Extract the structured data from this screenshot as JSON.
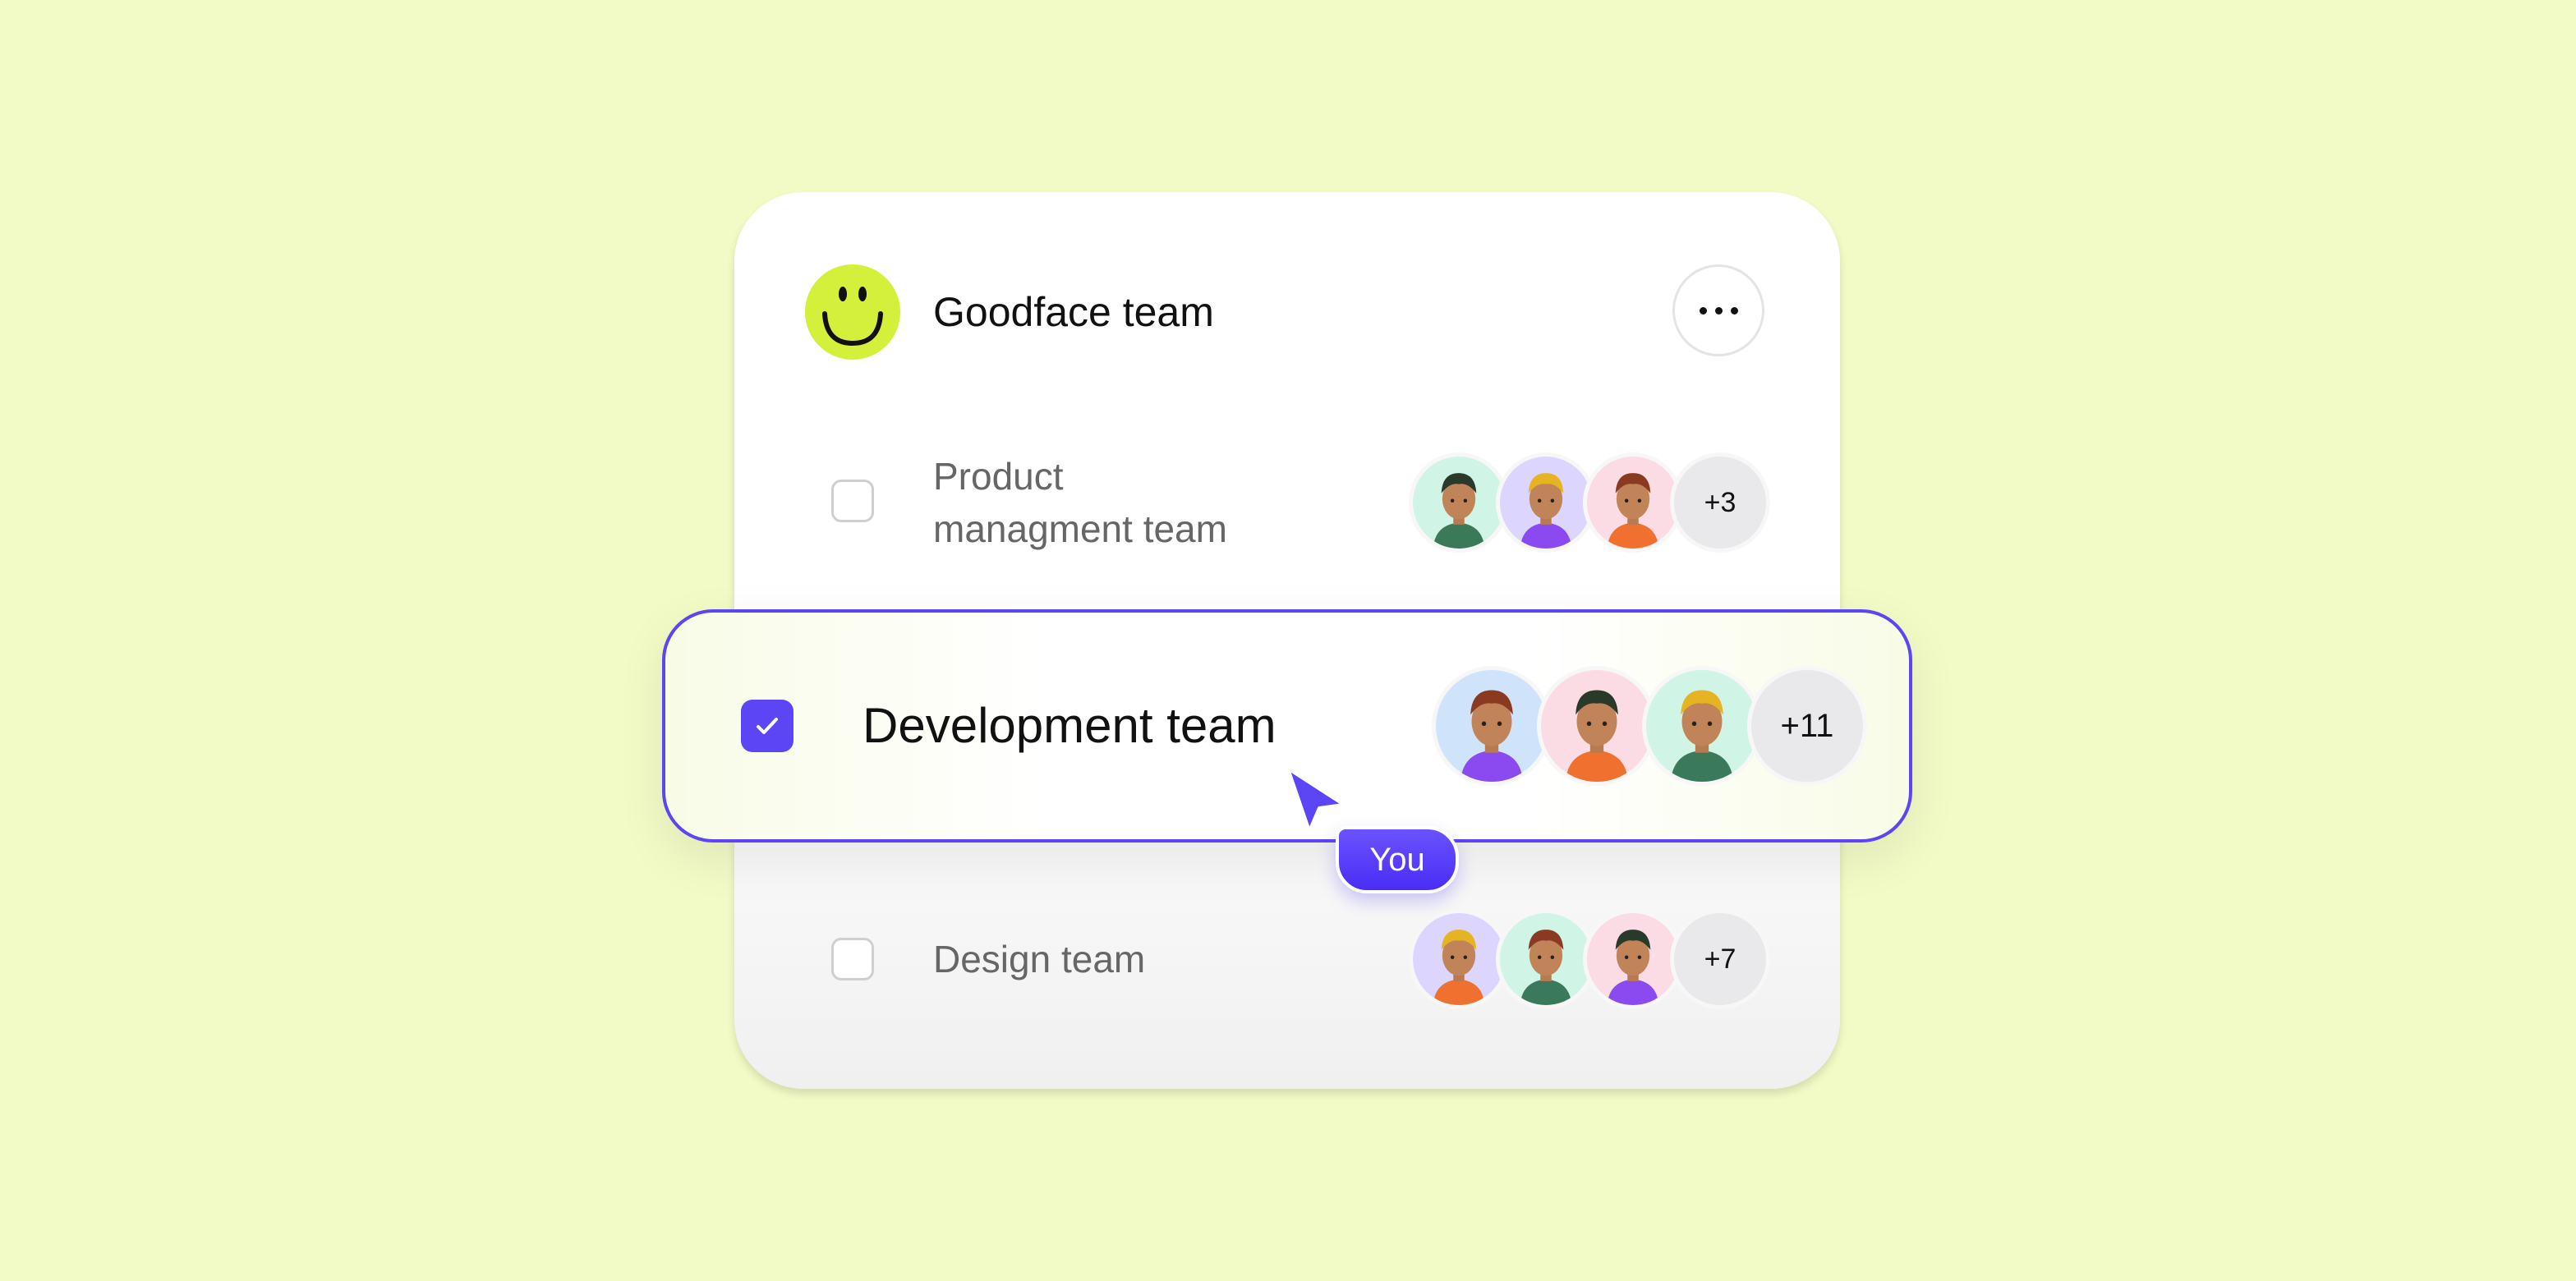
{
  "team": {
    "name": "Goodface team",
    "logo_icon": "smiley-icon",
    "logo_color": "#d4f03a",
    "more_icon": "ellipsis-icon"
  },
  "rows": [
    {
      "label_line1": "Product",
      "label_line2": "managment team",
      "checked": false,
      "extra_count": "+3",
      "avatar_bgs": [
        "#d0f5e6",
        "#dcd6ff",
        "#fbdce4"
      ]
    },
    {
      "label": "Development team",
      "checked": true,
      "extra_count": "+11",
      "avatar_bgs": [
        "#cfe4fb",
        "#fbdce4",
        "#d0f5e6"
      ]
    },
    {
      "label": "Design team",
      "checked": false,
      "extra_count": "+7",
      "avatar_bgs": [
        "#dcd6ff",
        "#d0f5e6",
        "#fbdce4"
      ]
    }
  ],
  "cursor": {
    "label": "You",
    "color": "#5b45f5"
  },
  "colors": {
    "background": "#f2fac6",
    "accent": "#5b45f5"
  }
}
